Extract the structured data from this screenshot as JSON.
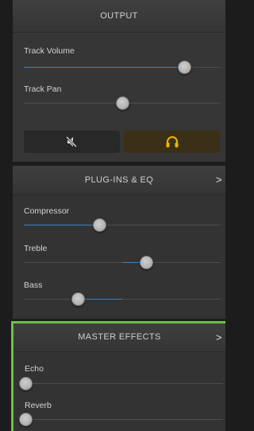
{
  "output": {
    "header": "OUTPUT",
    "track_volume": {
      "label": "Track Volume",
      "value": 0.86
    },
    "track_pan": {
      "label": "Track Pan",
      "value": 0.5
    },
    "mute_button": {
      "icon": "speaker-mute-icon"
    },
    "headphones_button": {
      "icon": "headphones-icon",
      "color": "#f0b400"
    }
  },
  "plugins": {
    "header": "PLUG-INS & EQ",
    "chevron": ">",
    "compressor": {
      "label": "Compressor",
      "value": 0.38
    },
    "treble": {
      "label": "Treble",
      "value": 0.6
    },
    "bass": {
      "label": "Bass",
      "value": 0.27
    }
  },
  "master": {
    "header": "MASTER EFFECTS",
    "chevron": ">",
    "highlight_color": "#6cc04a",
    "echo": {
      "label": "Echo",
      "value": 0.0
    },
    "reverb": {
      "label": "Reverb",
      "value": 0.0
    }
  }
}
